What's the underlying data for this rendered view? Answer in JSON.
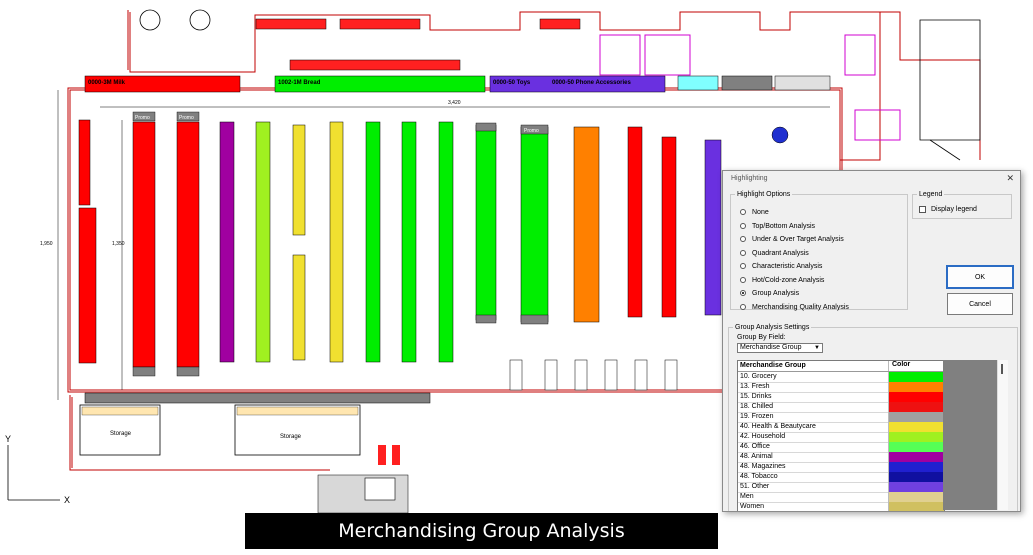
{
  "caption": "Merchandising Group Analysis",
  "plan": {
    "dimensions": {
      "top": "3,420",
      "left_outer": "1,950",
      "left_inner": "1,350"
    },
    "promo_label": "Promo",
    "storage_label": "Storage",
    "top_labels": {
      "milk": "0000-3M Milk",
      "bread": "1002-1M Bread",
      "toys": "0000-50 Toys",
      "phone": "0000-50 Phone Accessories"
    },
    "axis": {
      "y": "Y",
      "x": "X"
    }
  },
  "dialog": {
    "title": "Highlighting",
    "highlight_options_legend": "Highlight Options",
    "options": [
      {
        "label": "None",
        "selected": false
      },
      {
        "label": "Top/Bottom Analysis",
        "selected": false
      },
      {
        "label": "Under & Over Target Analysis",
        "selected": false
      },
      {
        "label": "Quadrant Analysis",
        "selected": false
      },
      {
        "label": "Characteristic Analysis",
        "selected": false
      },
      {
        "label": "Hot/Cold-zone Analysis",
        "selected": false
      },
      {
        "label": "Group Analysis",
        "selected": true
      },
      {
        "label": "Merchandising Quality Analysis",
        "selected": false
      }
    ],
    "legend_group": "Legend",
    "display_legend": "Display legend",
    "ok": "OK",
    "cancel": "Cancel",
    "group_settings_legend": "Group Analysis Settings",
    "group_by_label": "Group By Field:",
    "group_by_value": "Merchandise Group",
    "columns": [
      "Merchandise Group",
      "Color"
    ],
    "rows": [
      {
        "name": "10. Grocery",
        "color": "#00ee00"
      },
      {
        "name": "13. Fresh",
        "color": "#ff8000"
      },
      {
        "name": "15. Drinks",
        "color": "#ff0000"
      },
      {
        "name": "18. Chilled",
        "color": "#ee1111"
      },
      {
        "name": "19. Frozen",
        "color": "#a0a0a0"
      },
      {
        "name": "40. Health & Beautycare",
        "color": "#f0e030"
      },
      {
        "name": "42. Household",
        "color": "#a0f020"
      },
      {
        "name": "46. Office",
        "color": "#55ff55"
      },
      {
        "name": "48. Animal",
        "color": "#a000a0"
      },
      {
        "name": "48. Magazines",
        "color": "#2020d0"
      },
      {
        "name": "48. Tobacco",
        "color": "#1010a0"
      },
      {
        "name": "51. Other",
        "color": "#7040e0"
      },
      {
        "name": "Men",
        "color": "#e0d090"
      },
      {
        "name": "Women",
        "color": "#d0c060"
      }
    ]
  }
}
